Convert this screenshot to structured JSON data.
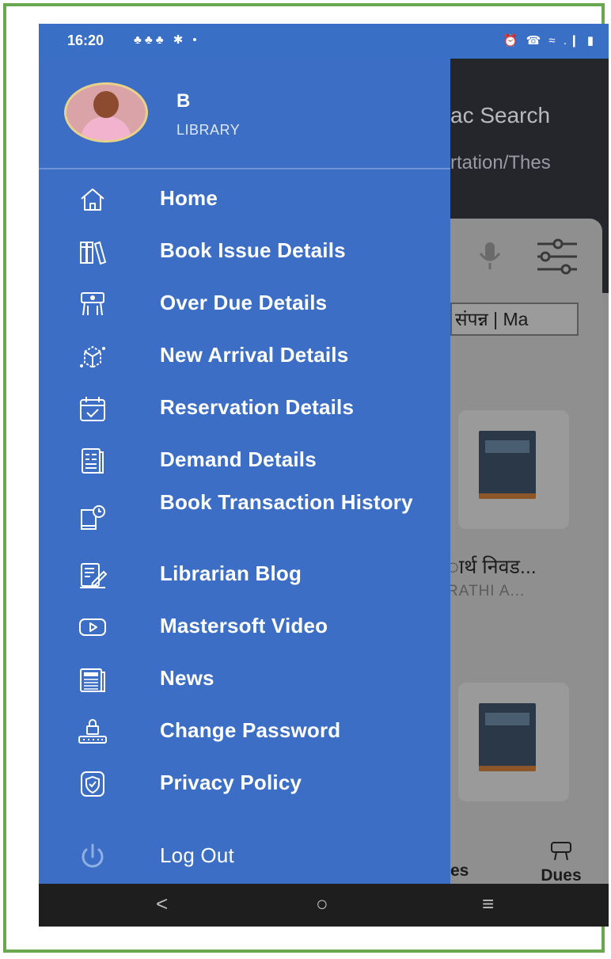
{
  "status_bar": {
    "time": "16:20",
    "left_icons": "♣♣♣ ✱ •",
    "right_icons": "⏰ ☎ ≈ .❙ ▮"
  },
  "drawer": {
    "user": {
      "name": "B",
      "role": "LIBRARY"
    },
    "menu": [
      {
        "label": "Home",
        "icon": "home-icon"
      },
      {
        "label": "Book Issue Details",
        "icon": "books-icon"
      },
      {
        "label": "Over Due Details",
        "icon": "overdue-icon"
      },
      {
        "label": "New Arrival Details",
        "icon": "new-arrival-icon"
      },
      {
        "label": "Reservation Details",
        "icon": "calendar-check-icon"
      },
      {
        "label": "Demand Details",
        "icon": "document-list-icon"
      },
      {
        "label": "Book Transaction History",
        "icon": "book-history-icon"
      },
      {
        "label": "Librarian Blog",
        "icon": "blog-icon"
      },
      {
        "label": "Mastersoft Video",
        "icon": "video-play-icon"
      },
      {
        "label": "News",
        "icon": "newspaper-icon"
      },
      {
        "label": "Change Password",
        "icon": "lock-icon"
      },
      {
        "label": "Privacy Policy",
        "icon": "shield-icon"
      }
    ],
    "logout": {
      "label": "Log Out",
      "icon": "power-icon"
    }
  },
  "background": {
    "title": "ac Search",
    "subtitle": "rtation/Thes",
    "chip": "संपन्न | Ma",
    "book_title": "ार्थ निवड...",
    "book_author": "RATHI A...",
    "nav_partial": "es",
    "nav_dues": "Dues"
  },
  "nav_bar": {
    "back": "<",
    "home": "○",
    "recent": "≡"
  },
  "colors": {
    "drawer": "#3b6ec4",
    "frame": "#6aa84f",
    "nav_bar": "#1e1e1e"
  }
}
